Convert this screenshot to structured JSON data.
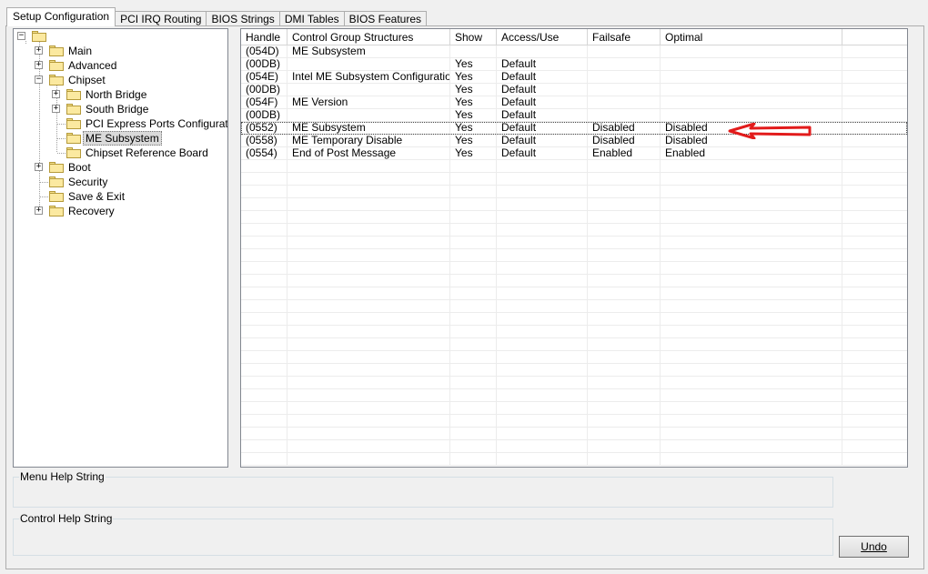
{
  "tabs": [
    {
      "label": "Setup Configuration"
    },
    {
      "label": "PCI IRQ Routing"
    },
    {
      "label": "BIOS Strings"
    },
    {
      "label": "DMI Tables"
    },
    {
      "label": "BIOS Features"
    }
  ],
  "tree": {
    "items": [
      {
        "label": "Main"
      },
      {
        "label": "Advanced"
      },
      {
        "label": "Chipset"
      },
      {
        "label": "North Bridge"
      },
      {
        "label": "South Bridge"
      },
      {
        "label": "PCI Express Ports Configuration"
      },
      {
        "label": "ME Subsystem"
      },
      {
        "label": "Chipset Reference Board"
      },
      {
        "label": "Boot"
      },
      {
        "label": "Security"
      },
      {
        "label": "Save & Exit"
      },
      {
        "label": "Recovery"
      }
    ]
  },
  "grid": {
    "columns": [
      "Handle",
      "Control Group Structures",
      "Show",
      "Access/Use",
      "Failsafe",
      "Optimal"
    ],
    "rows": [
      [
        "(054D)",
        "ME Subsystem",
        "",
        "",
        "",
        ""
      ],
      [
        "(00DB)",
        "",
        "Yes",
        "Default",
        "",
        ""
      ],
      [
        "(054E)",
        "Intel ME Subsystem Configuration",
        "Yes",
        "Default",
        "",
        ""
      ],
      [
        "(00DB)",
        "",
        "Yes",
        "Default",
        "",
        ""
      ],
      [
        "(054F)",
        "ME Version",
        "Yes",
        "Default",
        "",
        ""
      ],
      [
        "(00DB)",
        "",
        "Yes",
        "Default",
        "",
        ""
      ],
      [
        "(0552)",
        "ME Subsystem",
        "Yes",
        "Default",
        "Disabled",
        "Disabled"
      ],
      [
        "(0558)",
        "ME Temporary Disable",
        "Yes",
        "Default",
        "Disabled",
        "Disabled"
      ],
      [
        "(0554)",
        "End of Post Message",
        "Yes",
        "Default",
        "Enabled",
        "Enabled"
      ]
    ],
    "arrow_color": "#e21b1b"
  },
  "help": {
    "menu_label": "Menu Help String",
    "control_label": "Control Help String"
  },
  "buttons": {
    "undo": "Undo"
  }
}
